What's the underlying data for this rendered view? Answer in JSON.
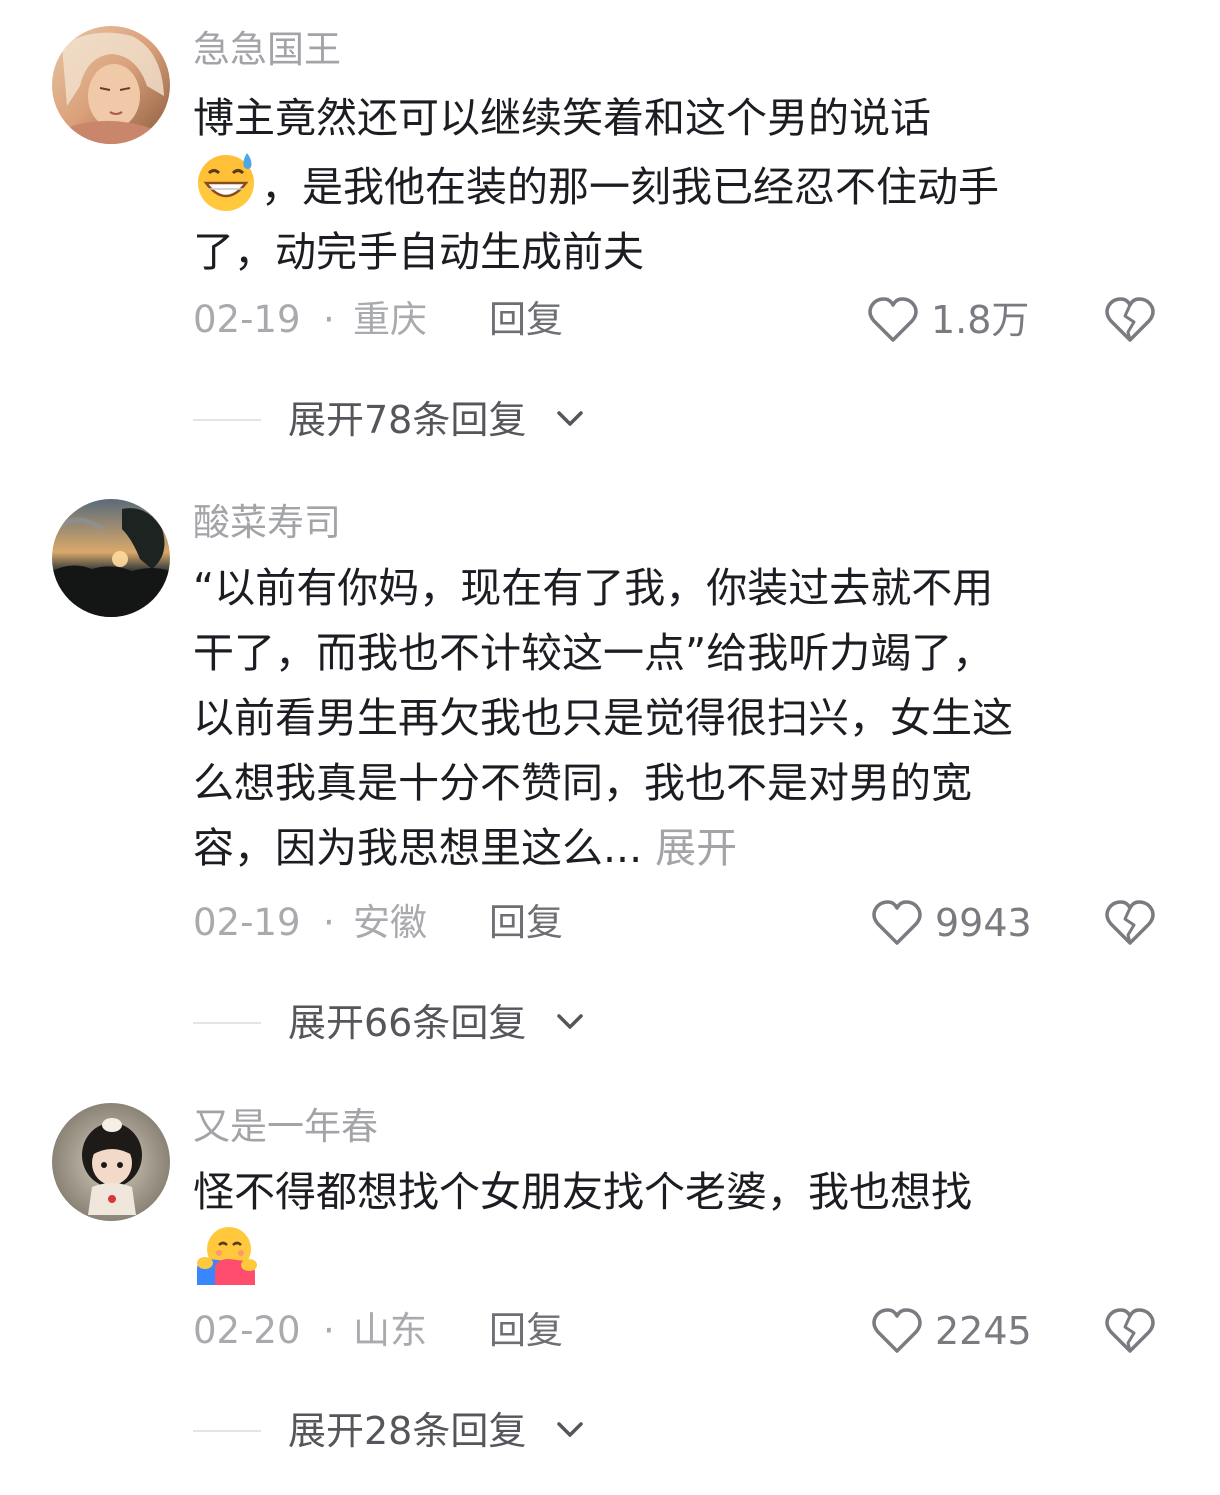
{
  "comments": [
    {
      "username": "急急国王",
      "lines": [
        "博主竟然还可以继续笑着和这个男的说话",
        "，是我他在装的那一刻我已经忍不住动手",
        "了，动完手自动生成前夫"
      ],
      "emoji": "grinning-sweat-emoji",
      "date": "02-19",
      "separator": "·",
      "location": "重庆",
      "reply_label": "回复",
      "like_count": "1.8万",
      "more_replies_label": "展开78条回复"
    },
    {
      "username": "酸菜寿司",
      "lines": [
        "“以前有你妈，现在有了我，你装过去就不用",
        "干了，而我也不计较这一点”给我听力竭了，",
        "以前看男生再欠我也只是觉得很扫兴，女生这",
        "么想我真是十分不赞同，我也不是对男的宽",
        "容，因为我思想里这么..."
      ],
      "expand_label": " 展开",
      "date": "02-19",
      "separator": "·",
      "location": "安徽",
      "reply_label": "回复",
      "like_count": "9943",
      "more_replies_label": "展开66条回复"
    },
    {
      "username": "又是一年春",
      "lines": [
        "怪不得都想找个女朋友找个老婆，我也想找"
      ],
      "emoji": "hugging-face-emoji",
      "date": "02-20",
      "separator": "·",
      "location": "山东",
      "reply_label": "回复",
      "like_count": "2245",
      "more_replies_label": "展开28条回复"
    }
  ],
  "colors": {
    "text": "#1c1d22",
    "muted": "#a3a4a8",
    "icon": "#7a7b80"
  },
  "icons": {
    "like": "heart-outline-icon",
    "dislike": "broken-heart-icon",
    "chevron": "chevron-down-icon"
  }
}
